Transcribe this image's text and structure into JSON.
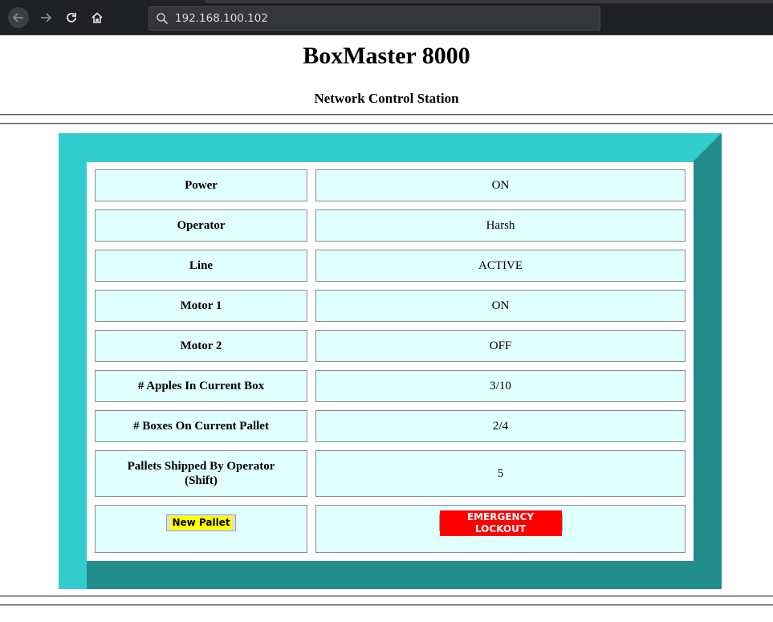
{
  "browser": {
    "url": "192.168.100.102"
  },
  "page": {
    "title": "BoxMaster 8000",
    "subtitle": "Network Control Station"
  },
  "colors": {
    "frame_light": "#33cccc",
    "frame_dark": "#228b8b",
    "cell_bg": "#e0ffff",
    "new_pallet_bg": "#ffff00",
    "emergency_bg": "#ff0000"
  },
  "status_table": {
    "rows": [
      {
        "label": "Power",
        "value": "ON"
      },
      {
        "label": "Operator",
        "value": "Harsh"
      },
      {
        "label": "Line",
        "value": "ACTIVE"
      },
      {
        "label": "Motor 1",
        "value": "ON"
      },
      {
        "label": "Motor 2",
        "value": "OFF"
      },
      {
        "label": "# Apples In Current Box",
        "value": "3/10"
      },
      {
        "label": "# Boxes On Current Pallet",
        "value": "2/4"
      },
      {
        "label": "Pallets Shipped By Operator (Shift)",
        "value": "5"
      }
    ],
    "actions": {
      "new_pallet_label": "New Pallet",
      "emergency_lockout_label": "EMERGENCY LOCKOUT"
    }
  },
  "icons": {
    "back": "arrow-left-icon",
    "forward": "arrow-right-icon",
    "reload": "reload-icon",
    "home": "home-icon",
    "search": "search-icon"
  }
}
